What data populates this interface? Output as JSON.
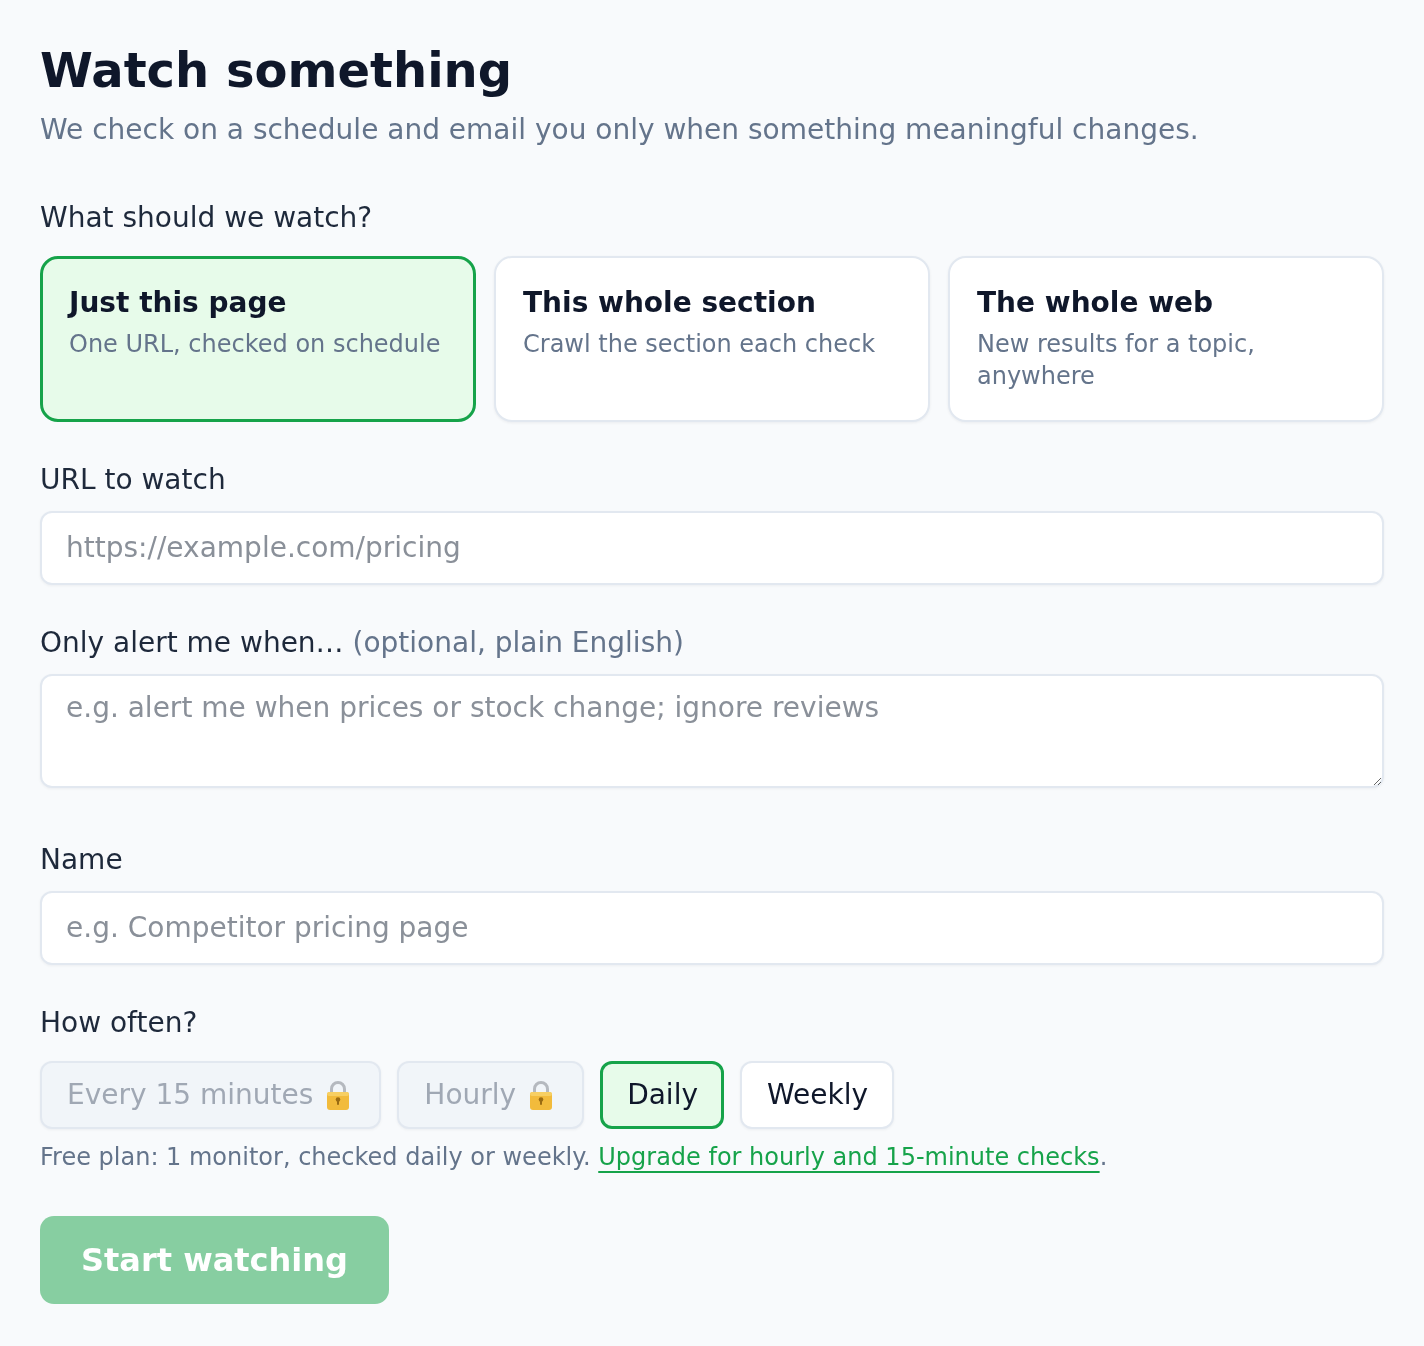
{
  "header": {
    "title": "Watch something",
    "subtitle": "We check on a schedule and email you only when something meaningful changes."
  },
  "watch_scope": {
    "label": "What should we watch?",
    "options": [
      {
        "title": "Just this page",
        "description": "One URL, checked on schedule",
        "selected": true
      },
      {
        "title": "This whole section",
        "description": "Crawl the section each check",
        "selected": false
      },
      {
        "title": "The whole web",
        "description": "New results for a topic, anywhere",
        "selected": false
      }
    ]
  },
  "url_field": {
    "label": "URL to watch",
    "placeholder": "https://example.com/pricing"
  },
  "condition_field": {
    "label": "Only alert me when…",
    "hint": "(optional, plain English)",
    "placeholder": "e.g. alert me when prices or stock change; ignore reviews"
  },
  "name_field": {
    "label": "Name",
    "placeholder": "e.g. Competitor pricing page"
  },
  "frequency": {
    "label": "How often?",
    "options": [
      {
        "label": "Every 15 minutes",
        "locked": true,
        "selected": false
      },
      {
        "label": "Hourly",
        "locked": true,
        "selected": false
      },
      {
        "label": "Daily",
        "locked": false,
        "selected": true
      },
      {
        "label": "Weekly",
        "locked": false,
        "selected": false
      }
    ],
    "note": "Free plan: 1 monitor, checked daily or weekly.",
    "upgrade_link": "Upgrade for hourly and 15-minute checks",
    "note_end": "."
  },
  "submit": {
    "label": "Start watching",
    "disabled": true
  }
}
